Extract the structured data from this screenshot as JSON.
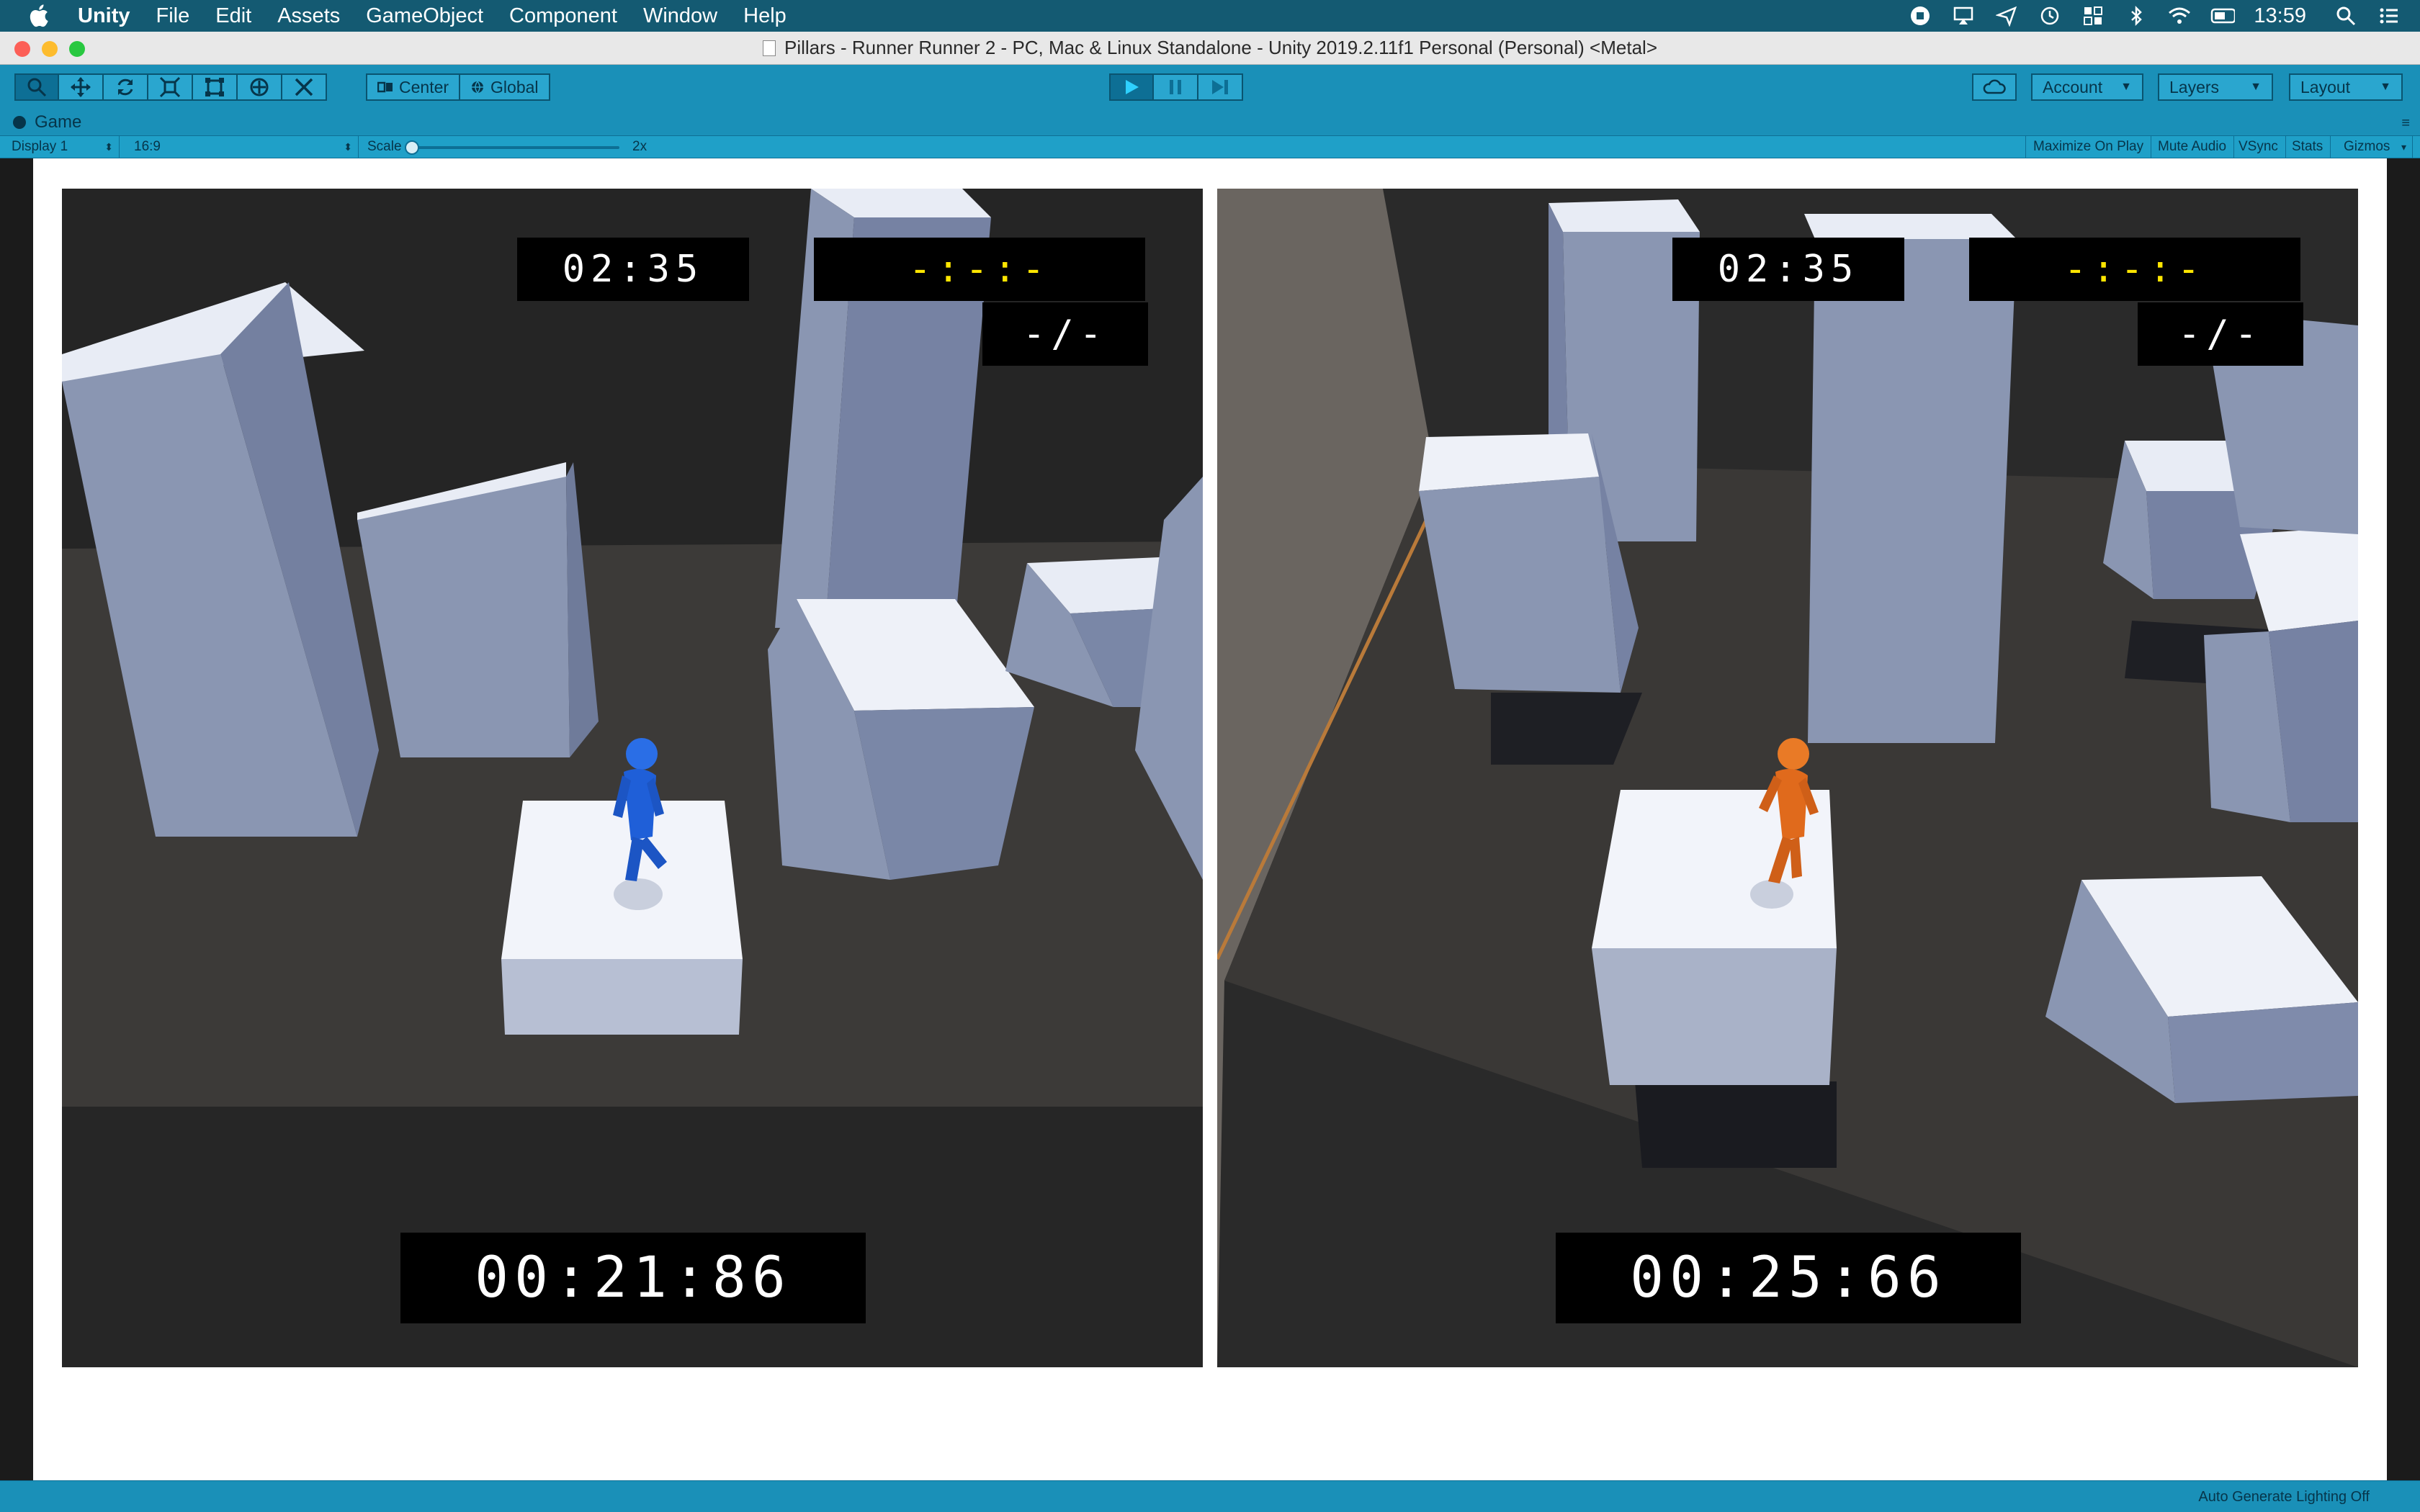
{
  "menubar": {
    "app": "Unity",
    "items": [
      "File",
      "Edit",
      "Assets",
      "GameObject",
      "Component",
      "Window",
      "Help"
    ],
    "clock": "13:59"
  },
  "window": {
    "title": "Pillars - Runner Runner 2 - PC, Mac & Linux Standalone - Unity 2019.2.11f1 Personal (Personal) <Metal>"
  },
  "toolbar": {
    "pivot_label": "Center",
    "space_label": "Global",
    "account_label": "Account",
    "layers_label": "Layers",
    "layout_label": "Layout"
  },
  "game_panel": {
    "tab_label": "Game",
    "display": "Display 1",
    "aspect": "16:9",
    "scale_label": "Scale",
    "scale_value": "2x",
    "scale_level": 0.0,
    "toggles": [
      "Maximize On Play",
      "Mute Audio",
      "VSync",
      "Stats",
      "Gizmos"
    ]
  },
  "players": [
    {
      "race_time": "02:35",
      "best_time": "-:-:-",
      "count": "-/-",
      "current_time": "00:21:86",
      "color": "#1f5fd8"
    },
    {
      "race_time": "02:35",
      "best_time": "-:-:-",
      "count": "-/-",
      "current_time": "00:25:66",
      "color": "#e06a1c"
    }
  ],
  "status_bar": {
    "text": "Auto Generate Lighting Off"
  },
  "colors": {
    "toolbar": "#1a90b8",
    "menubar": "#145a72",
    "hud_highlight": "#ffe600"
  }
}
